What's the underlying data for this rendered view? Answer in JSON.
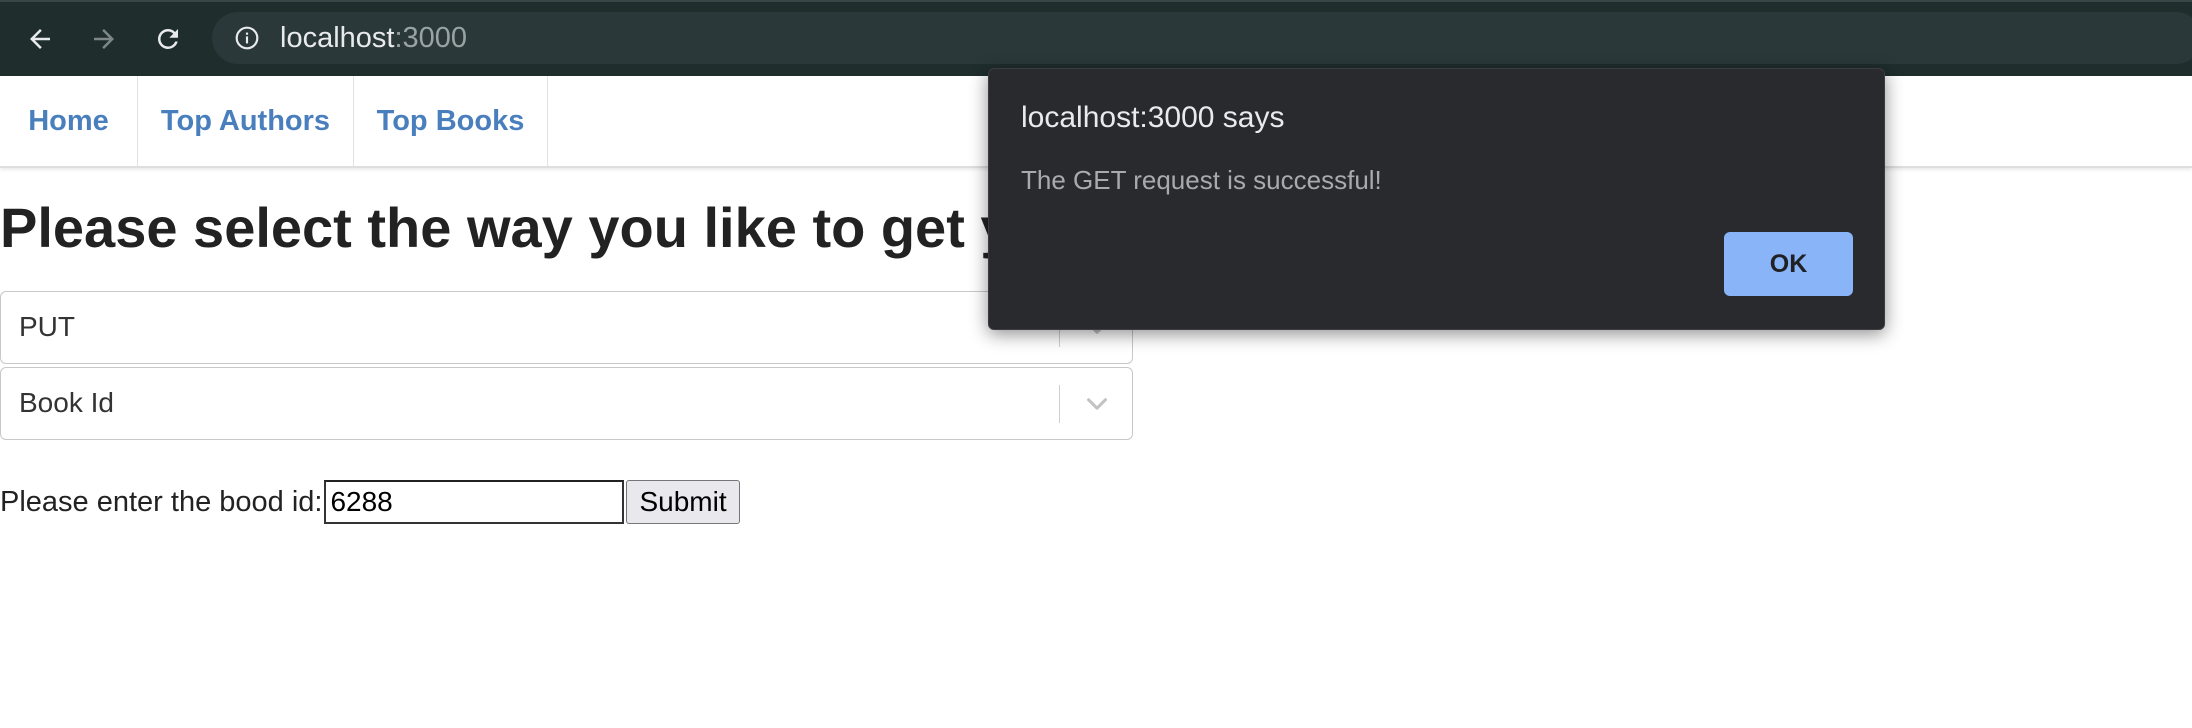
{
  "browser": {
    "url_host": "localhost",
    "url_port": ":3000",
    "back_icon": "arrow-left-icon",
    "forward_icon": "arrow-right-icon",
    "reload_icon": "reload-icon",
    "site_info_icon": "info-icon"
  },
  "nav": {
    "items": [
      "Home",
      "Top Authors",
      "Top Books"
    ]
  },
  "main": {
    "heading": "Please select the way you like to get you",
    "method_select": {
      "value": "PUT"
    },
    "field_select": {
      "value": "Book Id"
    },
    "form": {
      "label": "Please enter the bood id:",
      "input_value": "6288",
      "submit_label": "Submit"
    }
  },
  "dialog": {
    "title": "localhost:3000 says",
    "message": "The GET request is successful!",
    "ok_label": "OK"
  },
  "colors": {
    "chrome_bg": "#1f2d2d",
    "nav_link": "#4a7fbd",
    "dialog_bg": "#292a2d",
    "dialog_button": "#8ab4f8"
  }
}
